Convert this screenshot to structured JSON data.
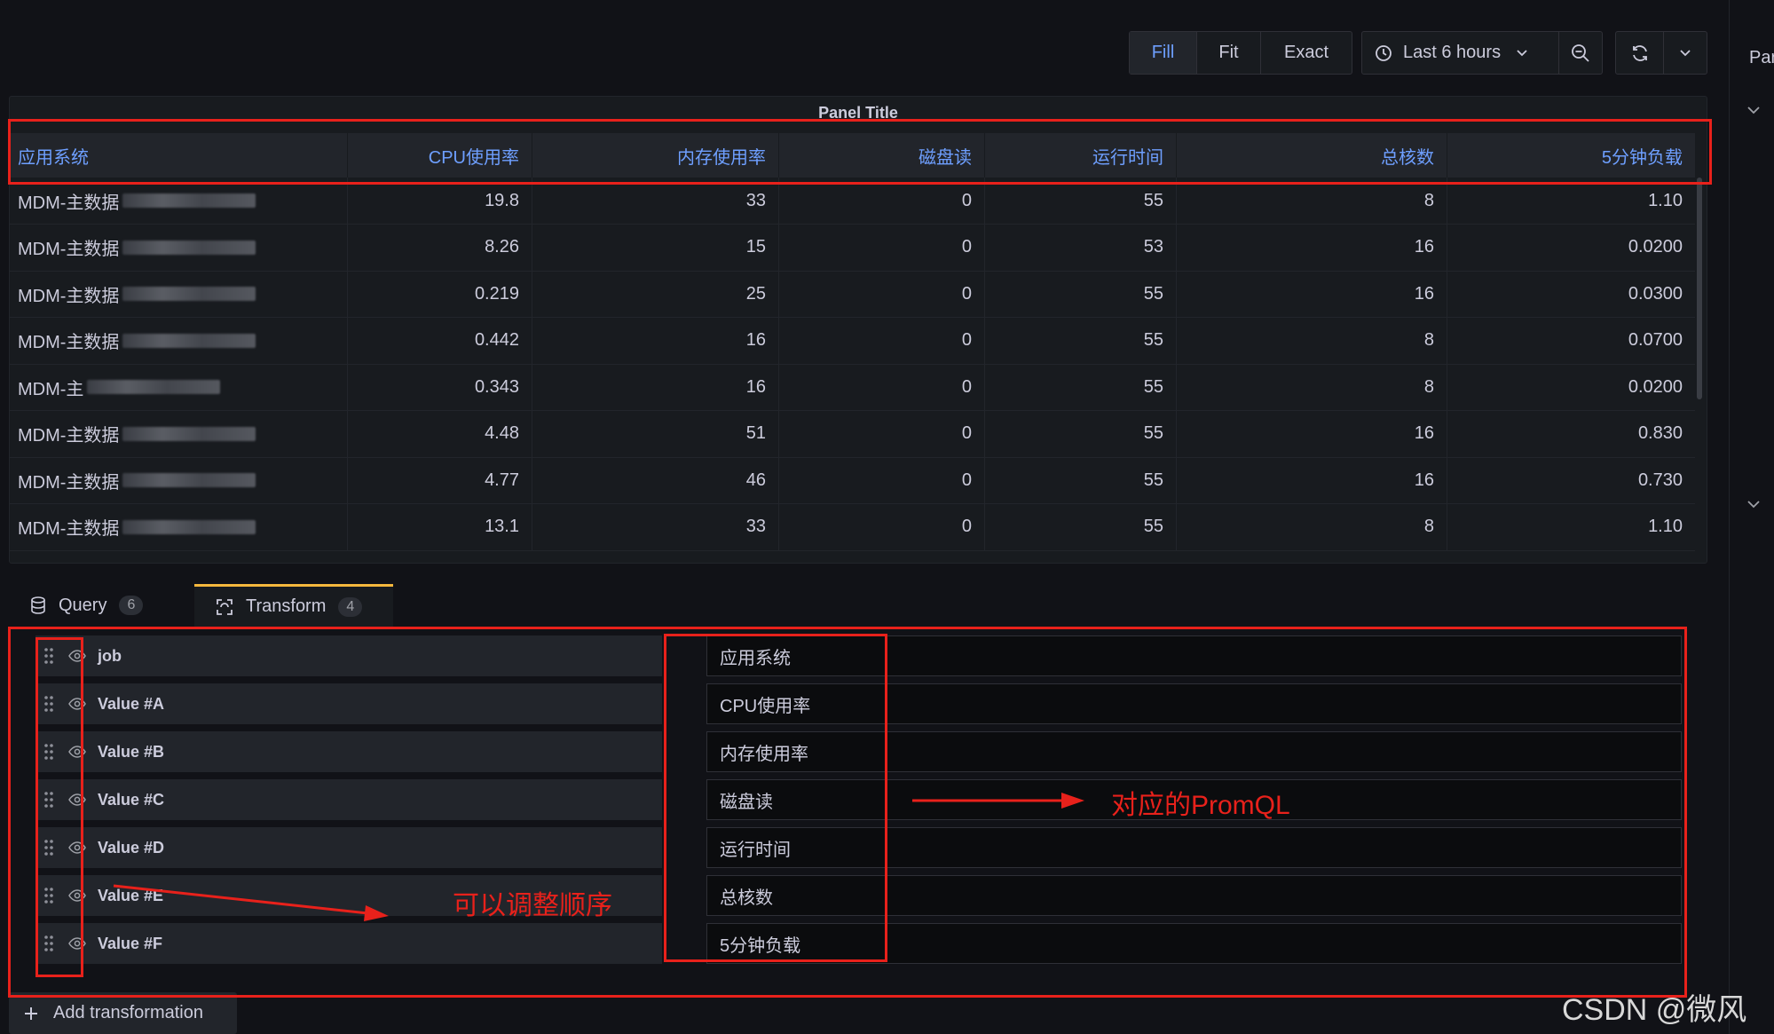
{
  "toolbar": {
    "view_modes": [
      "Fill",
      "Fit",
      "Exact"
    ],
    "active_view_mode": "Fill",
    "time_range": "Last 6 hours"
  },
  "right_panel": {
    "label": "Par"
  },
  "panel": {
    "title": "Panel Title",
    "columns": [
      "应用系统",
      "CPU使用率",
      "内存使用率",
      "磁盘读",
      "运行时间",
      "总核数",
      "5分钟负载"
    ],
    "rows": [
      [
        "MDM-主数据",
        "19.8",
        "33",
        "0",
        "55",
        "8",
        "1.10"
      ],
      [
        "MDM-主数据",
        "8.26",
        "15",
        "0",
        "53",
        "16",
        "0.0200"
      ],
      [
        "MDM-主数据",
        "0.219",
        "25",
        "0",
        "55",
        "16",
        "0.0300"
      ],
      [
        "MDM-主数据",
        "0.442",
        "16",
        "0",
        "55",
        "8",
        "0.0700"
      ],
      [
        "MDM-主",
        "0.343",
        "16",
        "0",
        "55",
        "8",
        "0.0200"
      ],
      [
        "MDM-主数据",
        "4.48",
        "51",
        "0",
        "55",
        "16",
        "0.830"
      ],
      [
        "MDM-主数据",
        "4.77",
        "46",
        "0",
        "55",
        "16",
        "0.730"
      ],
      [
        "MDM-主数据",
        "13.1",
        "33",
        "0",
        "55",
        "8",
        "1.10"
      ]
    ]
  },
  "tabs": [
    {
      "label": "Query",
      "count": "6",
      "icon": "database-icon"
    },
    {
      "label": "Transform",
      "count": "4",
      "icon": "transform-icon"
    }
  ],
  "transform": {
    "fields": [
      {
        "name": "job",
        "display": "应用系统"
      },
      {
        "name": "Value #A",
        "display": "CPU使用率"
      },
      {
        "name": "Value #B",
        "display": "内存使用率"
      },
      {
        "name": "Value #C",
        "display": "磁盘读"
      },
      {
        "name": "Value #D",
        "display": "运行时间"
      },
      {
        "name": "Value #E",
        "display": "总核数"
      },
      {
        "name": "Value #F",
        "display": "5分钟负载"
      }
    ],
    "add_label": "Add transformation"
  },
  "annotations": {
    "reorder_note": "可以调整顺序",
    "promql_note": "对应的PromQL"
  },
  "watermark": "CSDN @微风",
  "colors": {
    "accent": "#6e9fff",
    "annotation": "#e8211b",
    "tab_active": "#f5b73d"
  }
}
